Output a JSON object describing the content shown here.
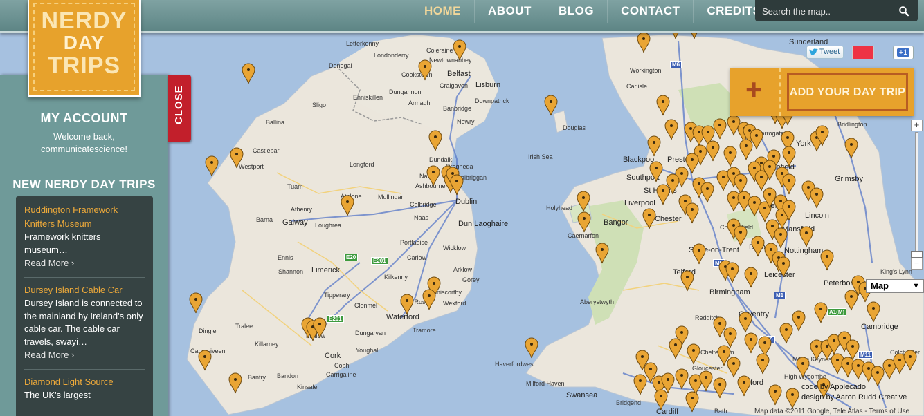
{
  "logo": {
    "line1": "NERDY",
    "line2": "DAY",
    "line3": "TRIPS"
  },
  "nav": {
    "items": [
      {
        "label": "HOME",
        "active": true
      },
      {
        "label": "ABOUT",
        "active": false
      },
      {
        "label": "BLOG",
        "active": false
      },
      {
        "label": "CONTACT",
        "active": false
      },
      {
        "label": "CREDITS",
        "active": false
      }
    ]
  },
  "search": {
    "placeholder": "Search the map..",
    "icon": "search-icon"
  },
  "sidebar": {
    "account_title": "MY ACCOUNT",
    "welcome_line1": "Welcome back,",
    "welcome_line2": "communicatescience!",
    "new_title": "NEW NERDY DAY TRIPS",
    "close_label": "CLOSE",
    "trips": [
      {
        "title": "Ruddington Framework Knitters Museum",
        "desc": "Framework knitters museum…",
        "more": "Read More ›"
      },
      {
        "title": "Dursey Island Cable Car",
        "desc": "Dursey Island is connected to the mainland by Ireland's only cable car. The cable car travels, swayi…",
        "more": "Read More ›"
      },
      {
        "title": "Diamond Light Source",
        "desc": "The UK's largest",
        "more": ""
      }
    ]
  },
  "add_trip": {
    "plus": "+",
    "label": "ADD YOUR DAY TRIP"
  },
  "social": {
    "tweet": "Tweet",
    "plusone": "+1"
  },
  "map": {
    "type_label": "Map",
    "zoom_in": "+",
    "zoom_out": "−",
    "sea_label": "Irish Sea",
    "places": [
      "Letterkenny",
      "Londonderry",
      "Coleraine",
      "Donegal",
      "Newtownabbey",
      "Belfast",
      "Lisburn",
      "Cookstown",
      "Craigavon",
      "Dungannon",
      "Armagh",
      "Downpatrick",
      "Banbridge",
      "Enniskillen",
      "Newry",
      "Sligo",
      "Ballina",
      "Castlebar",
      "Longford",
      "Westport",
      "Tuam",
      "Athlone",
      "Mullingar",
      "Athenry",
      "Galway",
      "Loughrea",
      "Barna",
      "Ennis",
      "Shannon",
      "Limerick",
      "Tipperary",
      "Clonmel",
      "Kilkenny",
      "Carlow",
      "Wexford",
      "Waterford",
      "Tramore",
      "Dungarvan",
      "Tralee",
      "Killarney",
      "Mallow",
      "Cork",
      "Cobh",
      "Carrigaline",
      "Youghal",
      "Bantry",
      "Bandon",
      "Kinsale",
      "Dingle",
      "Cahersiveen",
      "Drogheda",
      "Balbriggan",
      "Dublin",
      "Dun Laoghaire",
      "Naas",
      "Portlaoise",
      "Wicklow",
      "Arklow",
      "Gorey",
      "Enniscorthy",
      "New Ross",
      "Celbridge",
      "Ashbourne",
      "Navan",
      "Dundalk",
      "Holyhead",
      "Bangor",
      "Caernarfon",
      "Aberystwyth",
      "Haverfordwest",
      "Milford Haven",
      "Swansea",
      "Bridgend",
      "Cardiff",
      "Douglas",
      "Workington",
      "Carlisle",
      "Sunderland",
      "Harrogate",
      "York",
      "Bridlington",
      "Blackpool",
      "Preston",
      "Southport",
      "Liverpool",
      "St Helens",
      "Chester",
      "Wakefield",
      "Grimsby",
      "Sheffield",
      "Lincoln",
      "Mansfield",
      "Chesterfield",
      "Stoke-on-Trent",
      "Derby",
      "Nottingham",
      "Telford",
      "Leicester",
      "Peterborough",
      "King's Lynn",
      "Birmingham",
      "Coventry",
      "Redditch",
      "Cambridge",
      "Milton Keynes",
      "Cheltenham",
      "Gloucester",
      "Colchester",
      "High Wycombe",
      "Oxford",
      "Bath"
    ],
    "roads": [
      "M6",
      "E20",
      "E201",
      "E201",
      "A1(M)",
      "M1",
      "M40",
      "M11",
      "M6"
    ],
    "attribution_line1": "code by Applecado",
    "attribution_line2": "design by Aaron Rudd Creative",
    "map_data": "Map data ©2011 Google, Tele Atlas - Terms of Use"
  },
  "colors": {
    "accent": "#e7a22c",
    "header": "#6b9191",
    "sidebar": "#6f9a99",
    "close": "#c21f2b",
    "trip_title": "#eda93a"
  }
}
